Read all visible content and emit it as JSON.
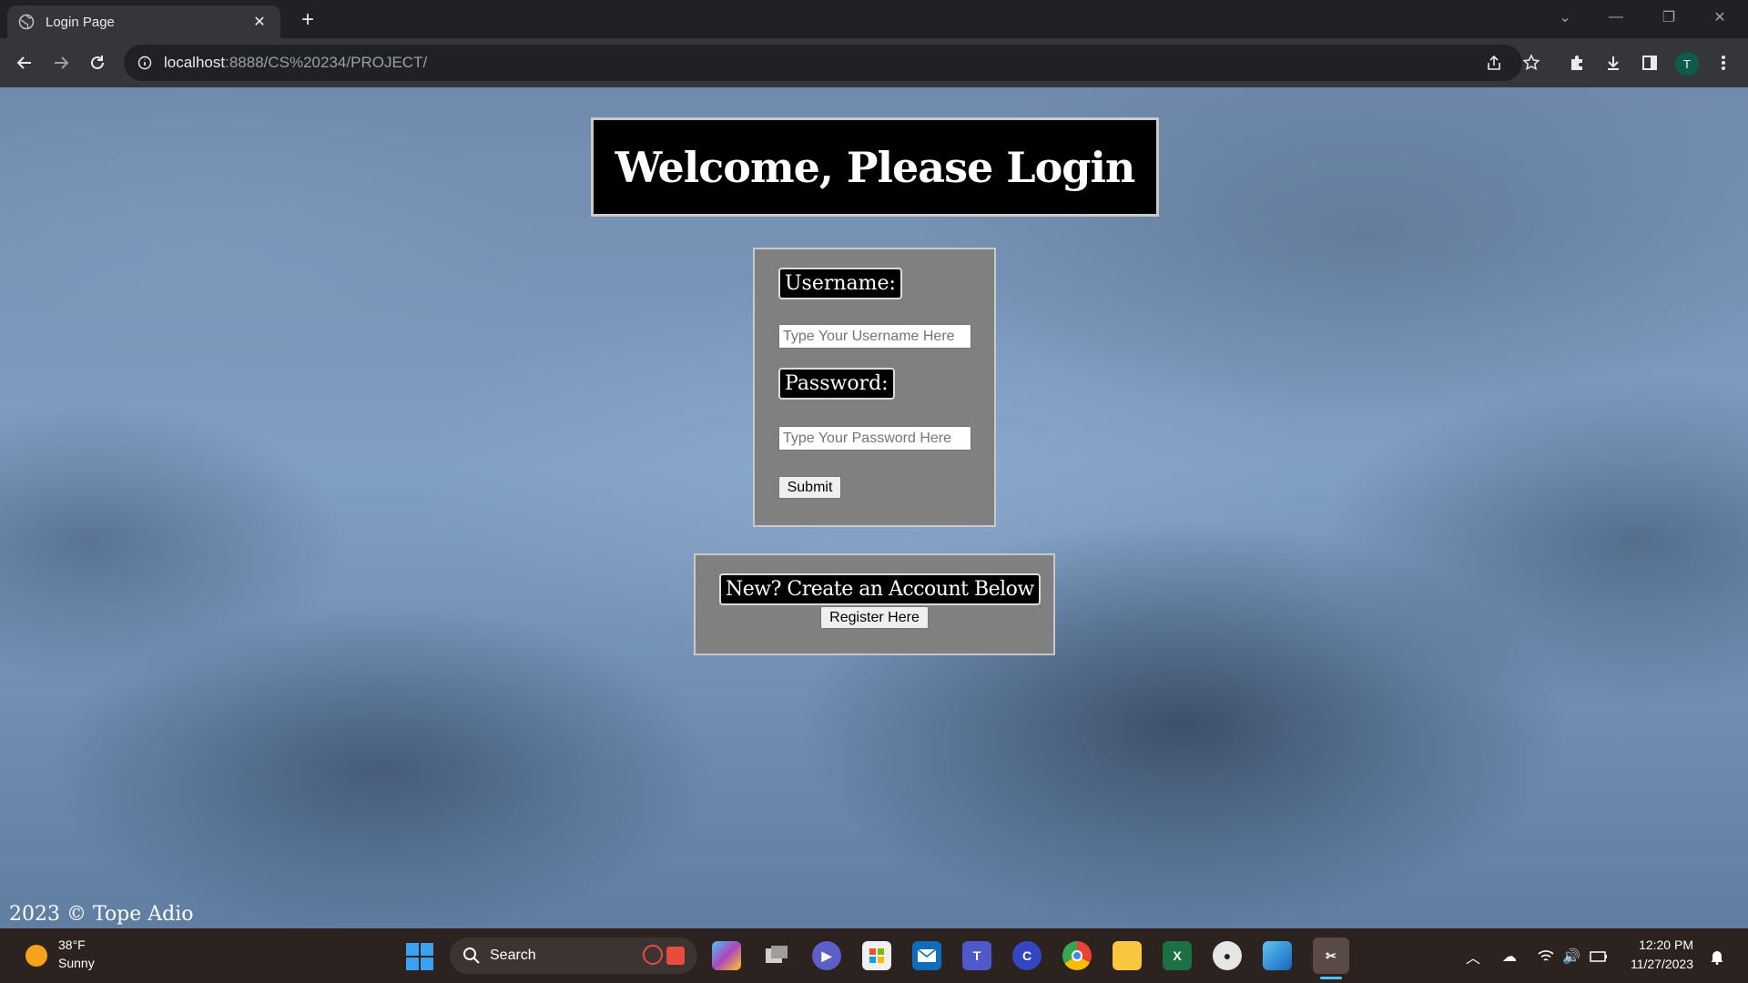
{
  "browser": {
    "tab_title": "Login Page",
    "url_host": "localhost",
    "url_path": ":8888/CS%20234/PROJECT/",
    "profile_initial": "T"
  },
  "page": {
    "heading": "Welcome, Please Login",
    "username_label": "Username:",
    "username_placeholder": "Type Your Username Here",
    "password_label": "Password:",
    "password_placeholder": "Type Your Password Here",
    "submit_label": "Submit",
    "register_prompt": "New? Create an Account Below",
    "register_button": "Register Here",
    "footer_credit": "2023 © Tope Adio"
  },
  "taskbar": {
    "weather_temp": "38°F",
    "weather_desc": "Sunny",
    "search_label": "Search",
    "clock_time": "12:20 PM",
    "clock_date": "11/27/2023",
    "apps": [
      "copilot",
      "task-view",
      "meet",
      "store",
      "mail",
      "teams",
      "cortana",
      "chrome",
      "file-explorer",
      "excel",
      "github",
      "photos",
      "snipping-tool"
    ]
  }
}
